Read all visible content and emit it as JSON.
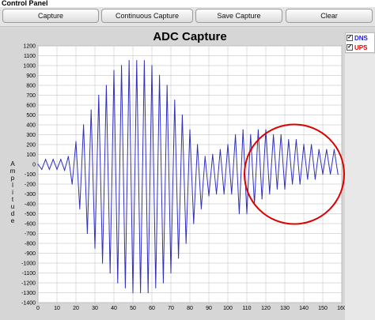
{
  "panel": {
    "title": "Control Panel"
  },
  "toolbar": {
    "capture_label": "Capture",
    "continuous_label": "Continuous Capture",
    "save_label": "Save Capture",
    "clear_label": "Clear"
  },
  "legend": {
    "items": [
      {
        "label": "DNS",
        "color": "#1f1fd8",
        "checked": true
      },
      {
        "label": "UPS",
        "color": "#e00000",
        "checked": true
      }
    ]
  },
  "colors": {
    "trace": "#3030c0",
    "annotation_circle": "#dd0000",
    "grid": "#cfcfcf"
  },
  "chart_data": {
    "type": "line",
    "title": "ADC Capture",
    "ylabel": "Amplitude",
    "xlabel": "",
    "xlim": [
      0,
      160
    ],
    "ylim": [
      -1400,
      1200
    ],
    "x_ticks": [
      0,
      10,
      20,
      30,
      40,
      50,
      60,
      70,
      80,
      90,
      100,
      110,
      120,
      130,
      140,
      150,
      160
    ],
    "y_ticks": [
      1200,
      1100,
      1000,
      900,
      800,
      700,
      600,
      500,
      400,
      300,
      200,
      100,
      0,
      -100,
      -200,
      -300,
      -400,
      -500,
      -600,
      -700,
      -800,
      -900,
      -1000,
      -1100,
      -1200,
      -1300,
      -1400
    ],
    "grid": true,
    "series": [
      {
        "name": "DNS",
        "x": [
          0,
          2,
          4,
          6,
          8,
          10,
          12,
          14,
          16,
          18,
          20,
          22,
          24,
          26,
          28,
          30,
          32,
          34,
          36,
          38,
          40,
          42,
          44,
          46,
          48,
          50,
          52,
          54,
          56,
          58,
          60,
          62,
          64,
          66,
          68,
          70,
          72,
          74,
          76,
          78,
          80,
          82,
          84,
          86,
          88,
          90,
          92,
          94,
          96,
          98,
          100,
          102,
          104,
          106,
          108,
          110,
          112,
          114,
          116,
          118,
          120,
          122,
          124,
          126,
          128,
          130,
          132,
          134,
          136,
          138,
          140,
          142,
          144,
          146,
          148,
          150,
          152,
          154,
          156,
          158
        ],
        "y": [
          0,
          -50,
          50,
          -50,
          50,
          -50,
          50,
          -60,
          80,
          -200,
          230,
          -450,
          400,
          -700,
          550,
          -850,
          700,
          -1000,
          800,
          -1100,
          950,
          -1200,
          1000,
          -1250,
          1050,
          -1300,
          1050,
          -1300,
          1050,
          -1300,
          1000,
          -1250,
          900,
          -1200,
          800,
          -1100,
          650,
          -950,
          500,
          -800,
          350,
          -600,
          200,
          -450,
          80,
          -320,
          100,
          -300,
          150,
          -300,
          200,
          -300,
          300,
          -500,
          350,
          -500,
          300,
          -400,
          350,
          -350,
          350,
          -300,
          300,
          -250,
          300,
          -250,
          250,
          -200,
          250,
          -200,
          200,
          -150,
          200,
          -150,
          150,
          -100,
          150,
          -100,
          150,
          -100
        ]
      }
    ],
    "annotations": [
      {
        "type": "circle",
        "x_center": 135,
        "y_center": -100,
        "note": ""
      }
    ]
  }
}
